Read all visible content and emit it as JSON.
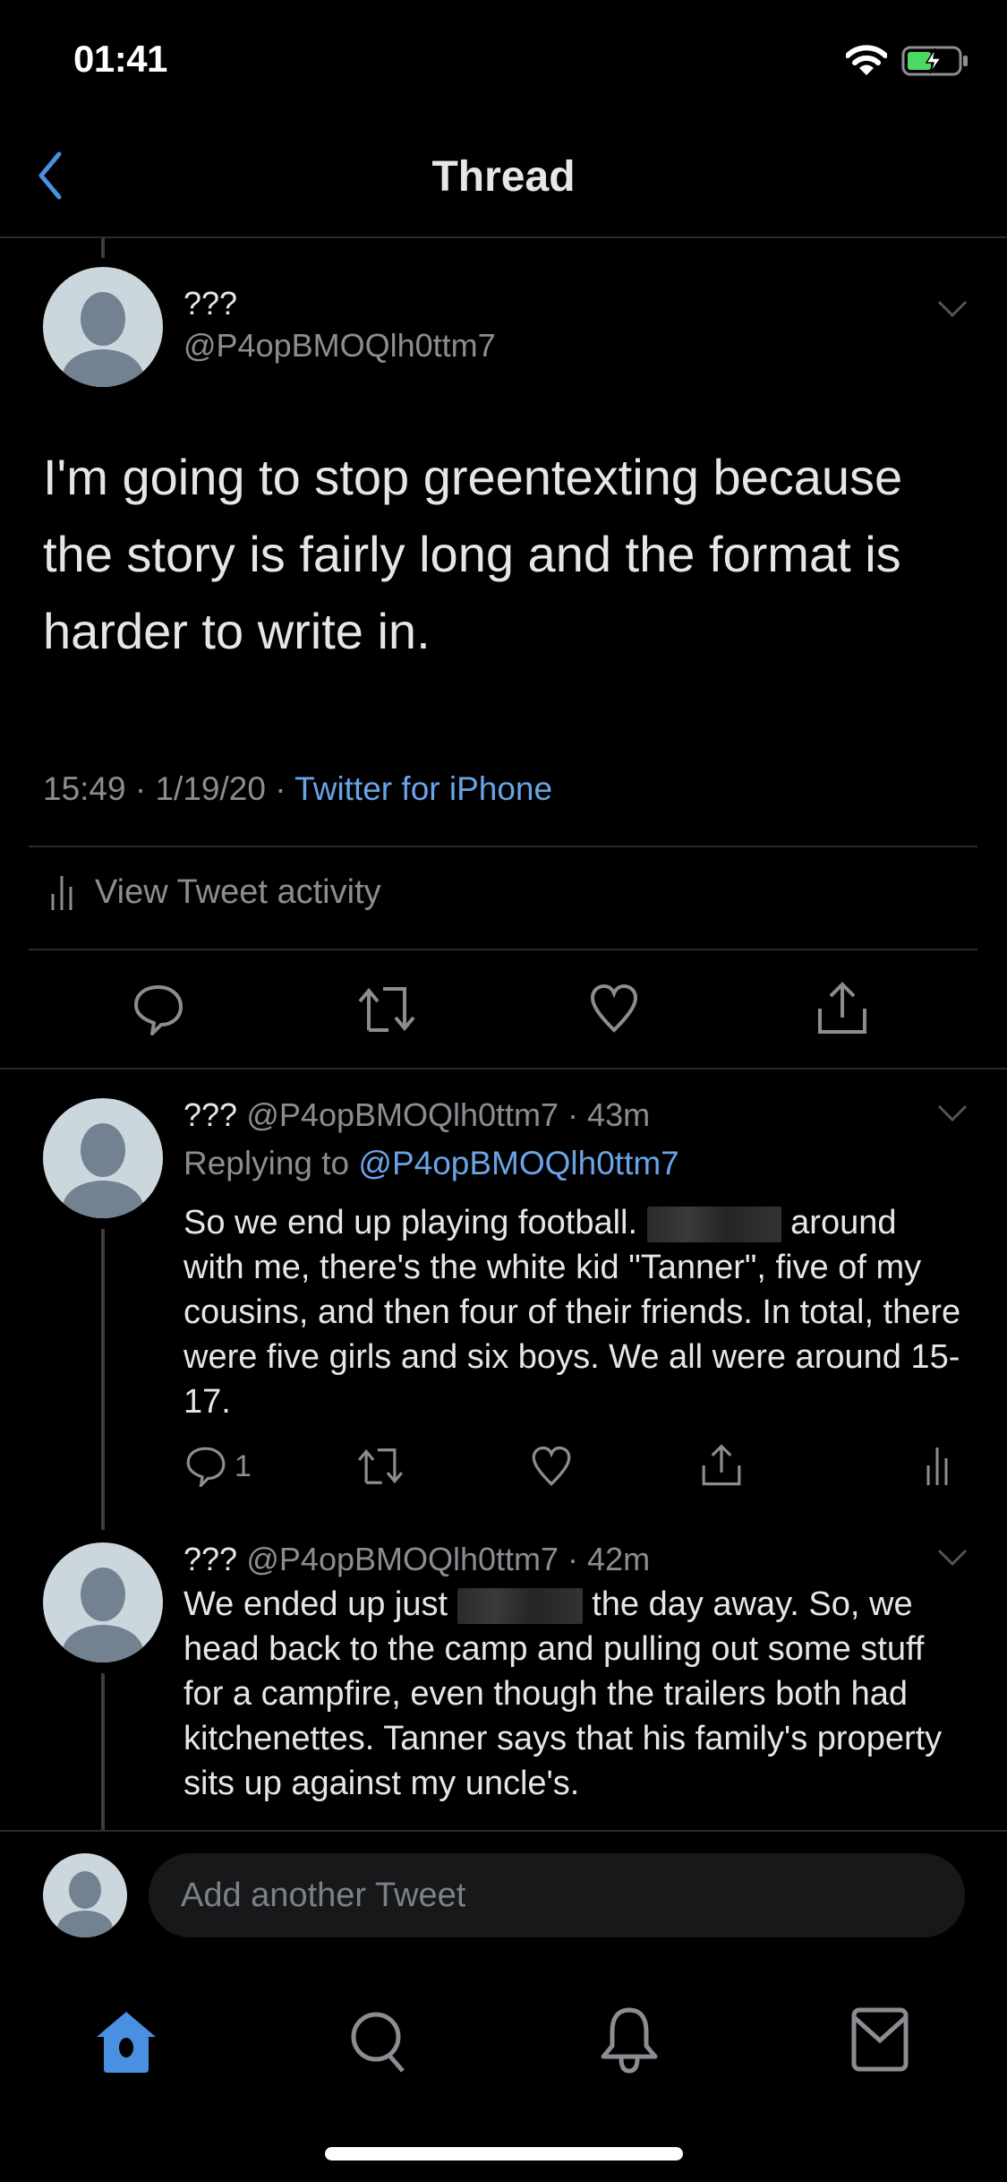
{
  "status_bar": {
    "time": "01:41",
    "wifi_icon": "wifi-icon",
    "battery_icon": "battery-charging-icon",
    "battery_color": "#4cd964"
  },
  "nav": {
    "title": "Thread",
    "back_icon": "chevron-left-icon",
    "accent": "#4a90e2"
  },
  "main_tweet": {
    "name": "???",
    "handle": "@P4opBMOQlh0ttm7",
    "text": "I'm going to stop greentexting because the story is fairly long and the format is harder to write in.",
    "time": "15:49",
    "date": "1/19/20",
    "separator": "·",
    "source": "Twitter for iPhone",
    "activity_label": "View Tweet activity",
    "actions": [
      "reply-icon",
      "retweet-icon",
      "like-icon",
      "share-icon"
    ]
  },
  "replies": [
    {
      "name": "???",
      "handle": "@P4opBMOQlh0ttm7",
      "age": "43m",
      "replying_prefix": "Replying to",
      "replying_to": "@P4opBMOQlh0ttm7",
      "text_before": "So we end up playing football.",
      "text_after": "around with me, there's the white kid \"Tanner\", five of my cousins, and then four of their friends. In total, there were five girls and six boys. We all were around 15-17.",
      "reply_count": "1"
    },
    {
      "name": "???",
      "handle": "@P4opBMOQlh0ttm7",
      "age": "42m",
      "text_before": "We ended up just",
      "text_after": "the day away. So, we head back to the camp and pulling out some stuff for a campfire, even though the trailers both had kitchenettes. Tanner says that his family's property sits up against my uncle's."
    }
  ],
  "composer": {
    "placeholder": "Add another Tweet"
  },
  "tab_bar": {
    "active_color": "#4a90e2",
    "items": [
      {
        "name": "home",
        "icon": "home-icon",
        "active": true
      },
      {
        "name": "search",
        "icon": "search-icon",
        "active": false
      },
      {
        "name": "notifications",
        "icon": "bell-icon",
        "active": false
      },
      {
        "name": "messages",
        "icon": "mail-icon",
        "active": false
      }
    ]
  }
}
